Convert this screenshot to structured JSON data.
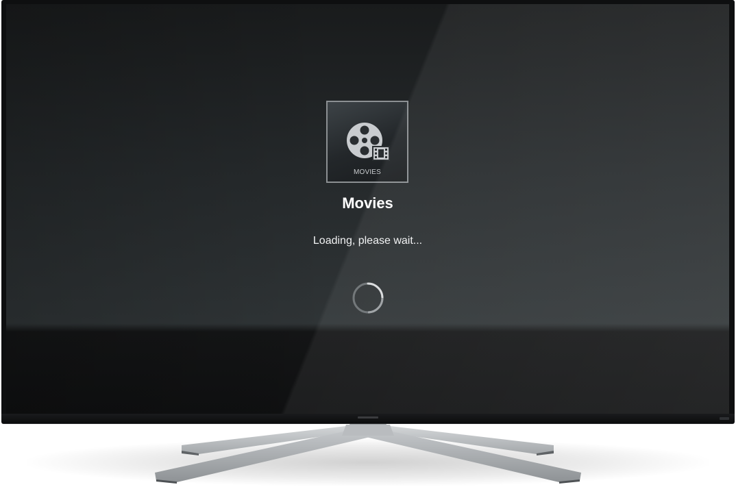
{
  "screen": {
    "tile_label": "MOVIES",
    "title": "Movies",
    "status": "Loading, please wait..."
  },
  "icons": {
    "tile": "film-reel-icon",
    "spinner": "loading-spinner-icon"
  },
  "colors": {
    "bezel": "#0e0f10",
    "screen_top": "#191b1c",
    "screen_mid": "#2f3436",
    "tile_border": "#8c9093",
    "icon": "#c9cccf",
    "stand": "#b4b7ba",
    "text": "#ffffff"
  }
}
